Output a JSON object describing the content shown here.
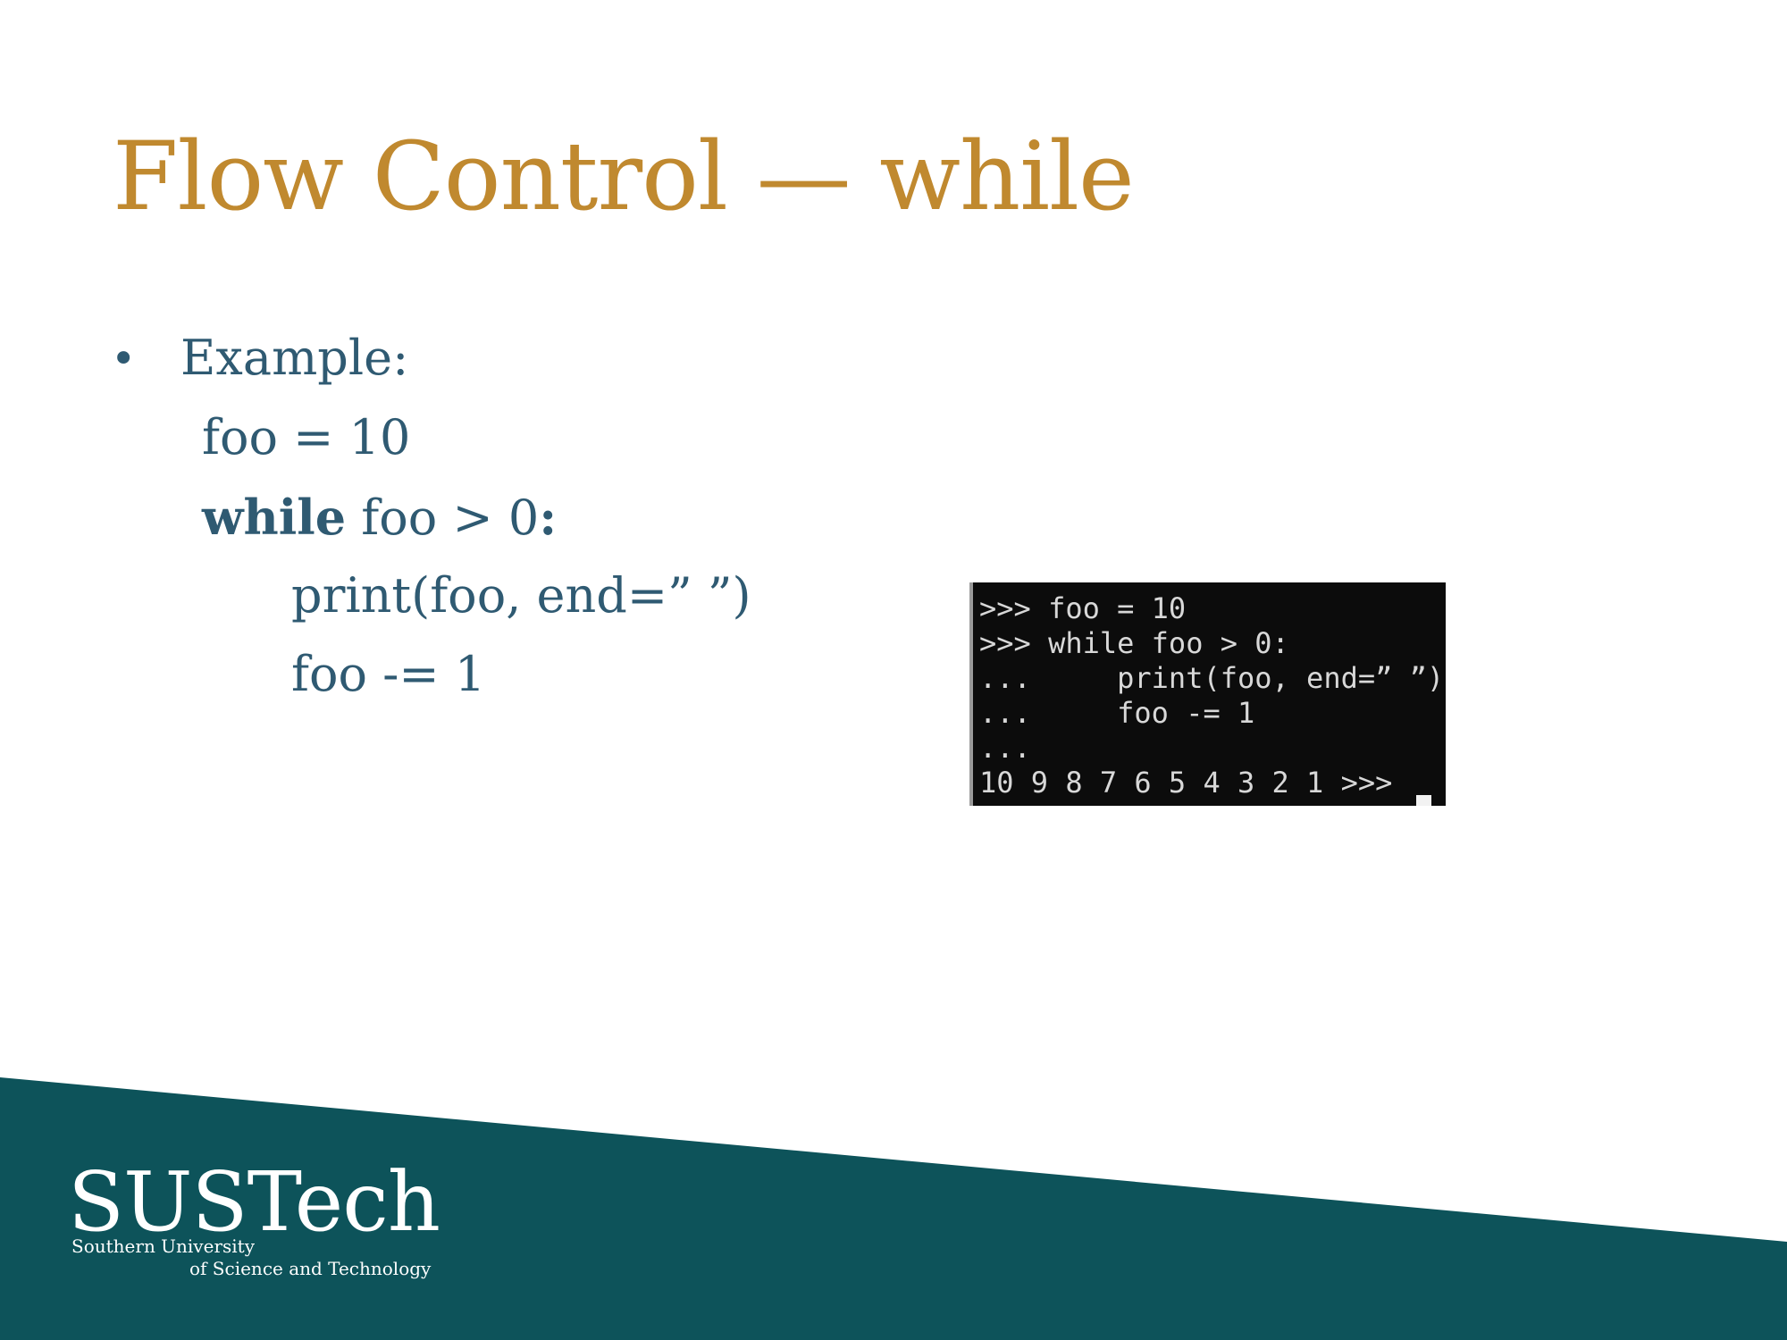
{
  "slide": {
    "title": "Flow Control — while",
    "bullet_symbol": "•",
    "bullet_label": "Example:",
    "code_lines": {
      "line1": "foo = 10",
      "line2_keyword": "while",
      "line2_rest": " foo > 0",
      "line2_colon": ":",
      "line3": "print(foo, end=” ”)",
      "line4": "foo -= 1"
    }
  },
  "console": {
    "lines": [
      ">>> foo = 10",
      ">>> while foo > 0:",
      "...     print(foo, end=” ”)",
      "...     foo -= 1",
      "...",
      "10 9 8 7 6 5 4 3 2 1 >>> "
    ]
  },
  "logo": {
    "name": "SUSTech",
    "line1": "Southern University",
    "line2": "of Science and Technology"
  },
  "colors": {
    "title": "#c0892f",
    "body_text": "#2f5a72",
    "footer_band": "#0d535a",
    "console_bg": "#0c0c0c",
    "console_text": "#d8d8d8"
  }
}
